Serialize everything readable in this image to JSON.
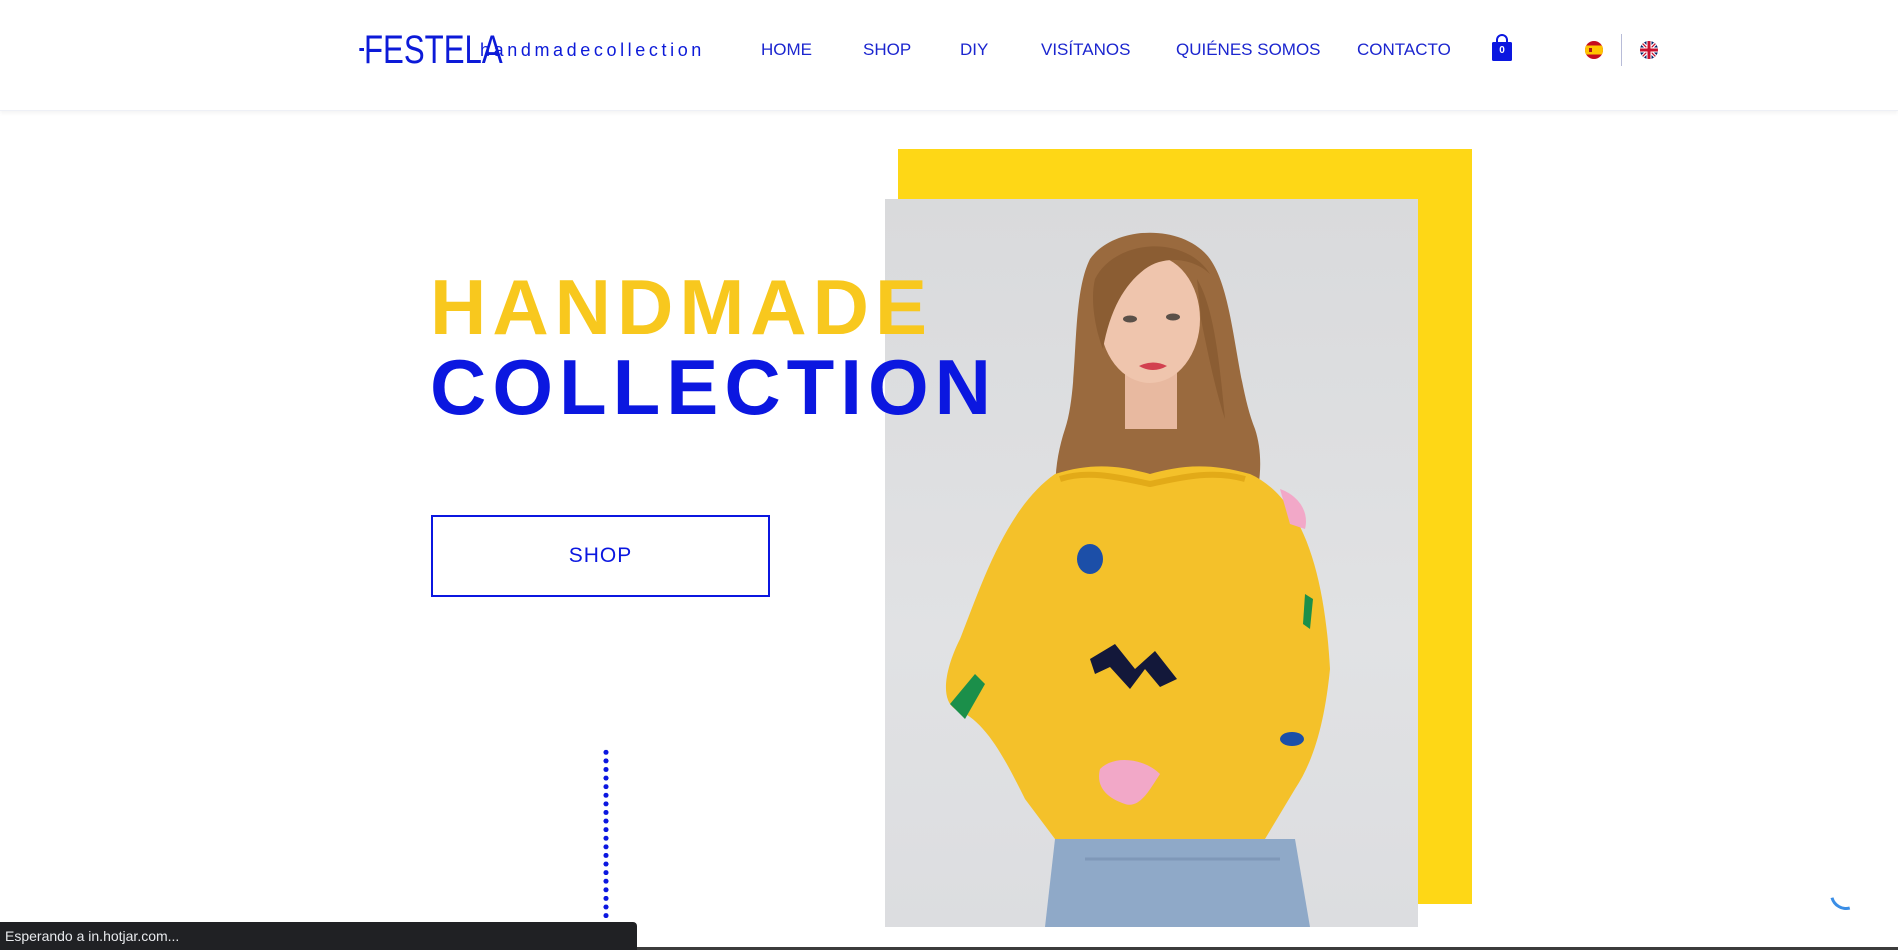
{
  "header": {
    "logo": "FESTELA",
    "logo_sub": "handmadecollection",
    "nav": [
      {
        "label": "HOME"
      },
      {
        "label": "SHOP"
      },
      {
        "label": "DIY"
      },
      {
        "label": "VISÍTANOS"
      },
      {
        "label": "QUIÉNES SOMOS"
      },
      {
        "label": "CONTACTO"
      }
    ],
    "cart_count": "0",
    "languages": [
      "es-flag-icon",
      "uk-flag-icon"
    ]
  },
  "hero": {
    "title_line1": "HANDMADE",
    "title_line2": "COLLECTION",
    "shop_button": "SHOP",
    "photo": "woman-in-yellow-sweatshirt"
  },
  "colors": {
    "brand_blue": "#0b17e0",
    "brand_yellow": "#fed716",
    "title_yellow": "#f8c81e"
  },
  "status_bar": {
    "text": "Esperando a in.hotjar.com..."
  }
}
